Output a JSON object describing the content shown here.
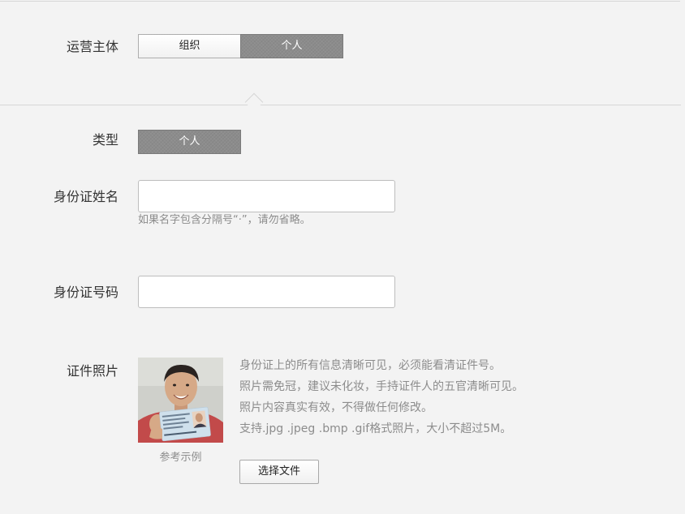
{
  "operator": {
    "label": "运营主体",
    "options": [
      "组织",
      "个人"
    ],
    "selected": "个人"
  },
  "type": {
    "label": "类型",
    "value": "个人"
  },
  "id_name": {
    "label": "身份证姓名",
    "value": "",
    "hint": "如果名字包含分隔号“·”，请勿省略。"
  },
  "id_number": {
    "label": "身份证号码",
    "value": ""
  },
  "id_photo": {
    "label": "证件照片",
    "example_caption": "参考示例",
    "requirements": [
      "身份证上的所有信息清晰可见，必须能看清证件号。",
      "照片需免冠，建议未化妆，手持证件人的五官清晰可见。",
      "照片内容真实有效，不得做任何修改。",
      "支持.jpg .jpeg .bmp .gif格式照片，大小不超过5M。"
    ],
    "choose_file_label": "选择文件"
  },
  "colors": {
    "background": "#f3f3f3",
    "selected_segment": "#8c8c8c",
    "hint_text": "#8c8c8c"
  }
}
